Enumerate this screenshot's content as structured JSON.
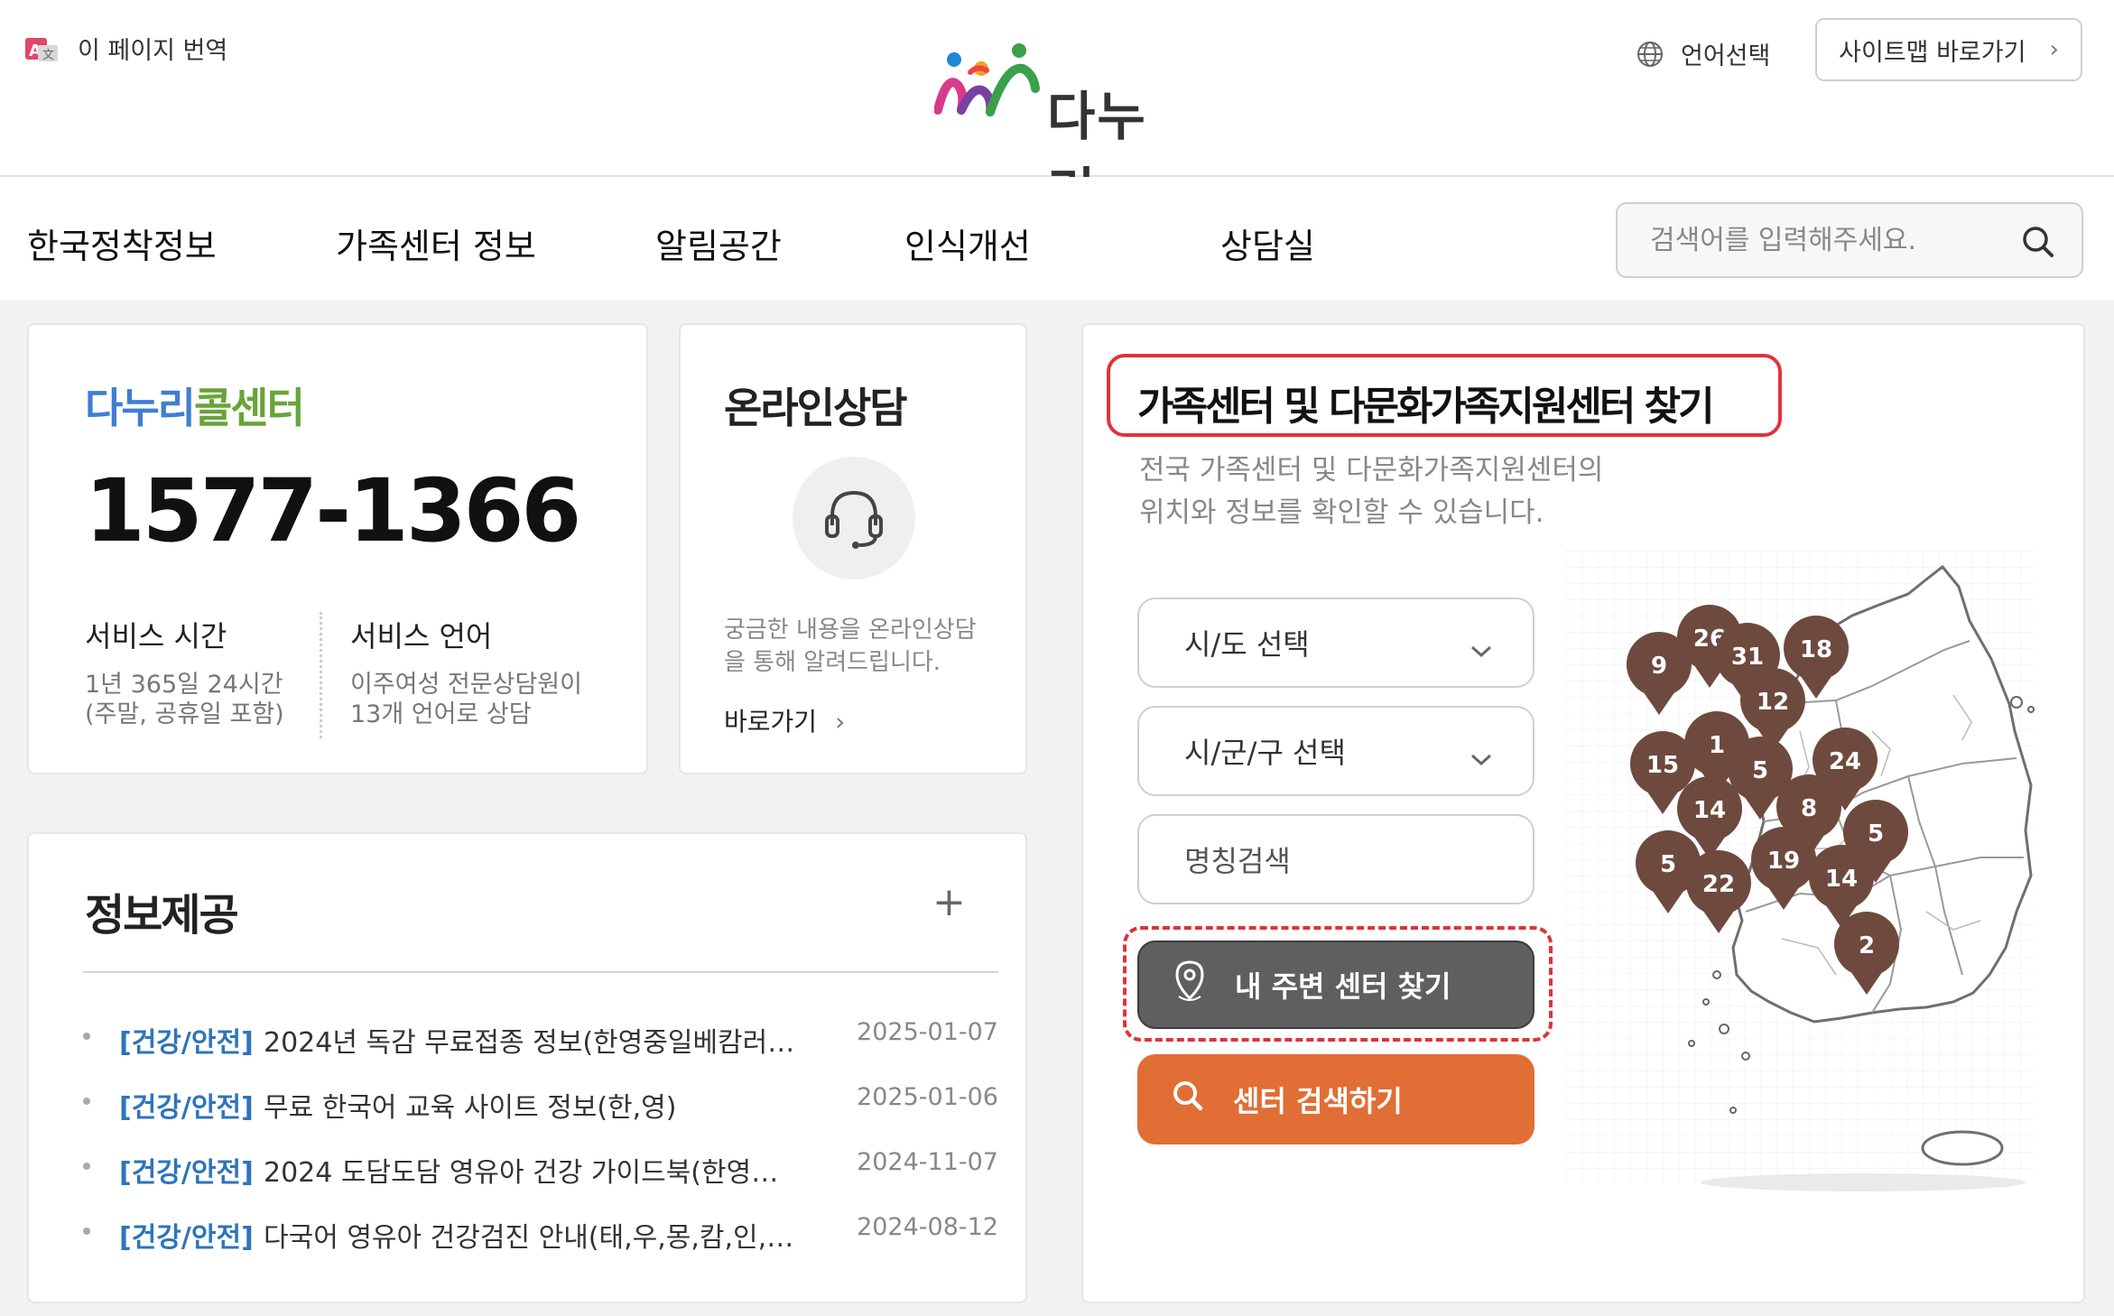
{
  "header": {
    "translate_label": "이 페이지 번역",
    "logo_text": "다누리",
    "language_label": "언어선택",
    "sitemap_label": "사이트맵 바로가기"
  },
  "nav": {
    "items": [
      "한국정착정보",
      "가족센터 정보",
      "알림공간",
      "인식개선",
      "상담실"
    ],
    "search_placeholder": "검색어를 입력해주세요."
  },
  "call_center": {
    "title_part1": "다누리",
    "title_part2": "콜센터",
    "phone": "1577-1366",
    "service_time_title": "서비스 시간",
    "service_time_line1": "1년 365일 24시간",
    "service_time_line2": "(주말, 공휴일 포함)",
    "service_lang_title": "서비스 언어",
    "service_lang_line1": "이주여성 전문상담원이",
    "service_lang_line2": "13개 언어로 상담"
  },
  "online": {
    "title": "온라인상담",
    "desc_line1": "궁금한 내용을 온라인상담",
    "desc_line2": "을 통해 알려드립니다.",
    "link_label": "바로가기"
  },
  "info": {
    "title": "정보제공",
    "plus": "+",
    "items": [
      {
        "category": "[건강/안전]",
        "text": "2024년 독감 무료접종 정보(한영중일베캄러…",
        "date": "2025-01-07"
      },
      {
        "category": "[건강/안전]",
        "text": "무료 한국어 교육 사이트 정보(한,영)",
        "date": "2025-01-06"
      },
      {
        "category": "[건강/안전]",
        "text": "2024 도담도담 영유아 건강 가이드북(한영…",
        "date": "2024-11-07"
      },
      {
        "category": "[건강/안전]",
        "text": "다국어 영유아 건강검진 안내(태,우,몽,캄,인,…",
        "date": "2024-08-12"
      }
    ]
  },
  "finder": {
    "title": "가족센터 및 다문화가족지원센터 찾기",
    "desc_line1": "전국 가족센터 및 다문화가족지원센터의",
    "desc_line2": "위치와 정보를 확인할 수 있습니다.",
    "sido_select": "시/도 선택",
    "sigungu_select": "시/군/구 선택",
    "name_search_placeholder": "명칭검색",
    "nearby_button": "내 주변 센터 찾기",
    "search_button": "센터 검색하기",
    "map_pins": [
      "9",
      "26",
      "31",
      "18",
      "12",
      "1",
      "15",
      "5",
      "24",
      "14",
      "8",
      "5",
      "19",
      "14",
      "5",
      "22",
      "2"
    ]
  },
  "colors": {
    "accent_orange": "#e06e35",
    "pin_brown": "#6e4a3e",
    "highlight_red": "#e0333b",
    "link_blue": "#2d74bb"
  }
}
